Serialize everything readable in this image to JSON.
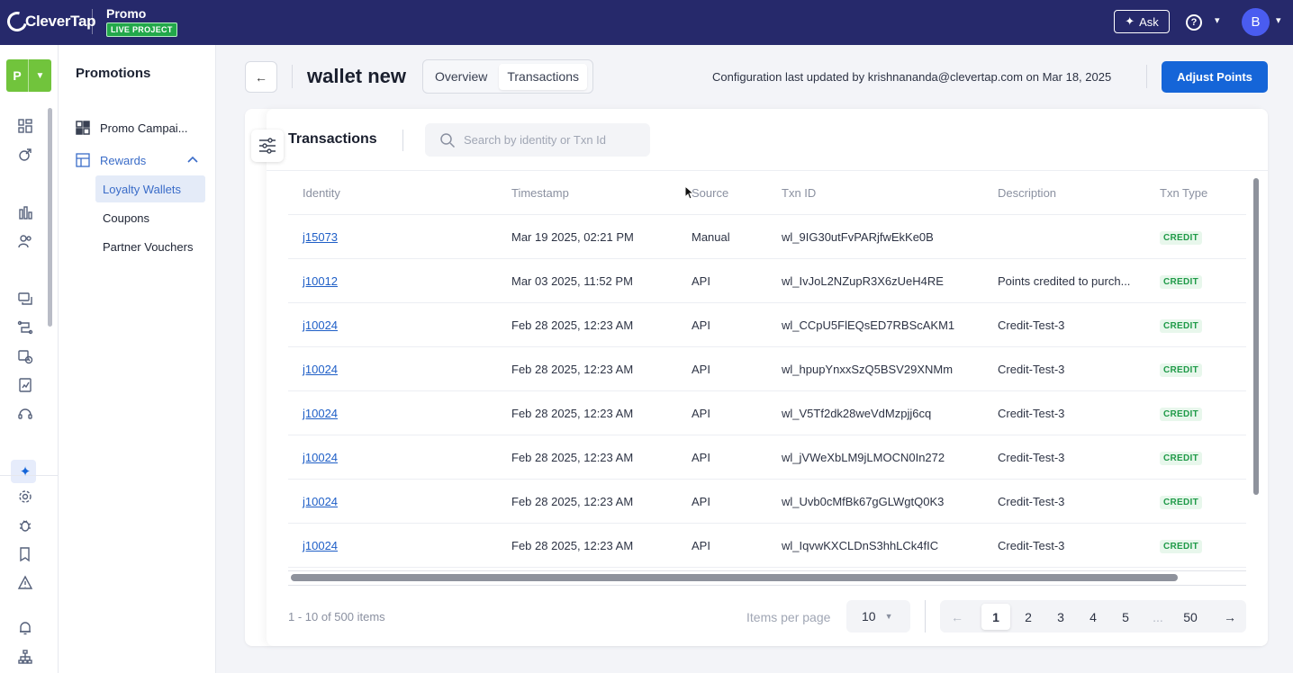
{
  "topbar": {
    "logo_text": "CleverTap",
    "project_name": "Promo",
    "project_badge": "LIVE PROJECT",
    "ask_label": "Ask",
    "help_glyph": "?",
    "avatar_initial": "B"
  },
  "workspace": {
    "initial": "P",
    "color": "#71c43c"
  },
  "sidenav": {
    "title": "Promotions",
    "items": [
      {
        "label": "Promo Campai...",
        "icon": "grid-icon"
      },
      {
        "label": "Rewards",
        "icon": "layout-icon",
        "expanded": true
      }
    ],
    "sub_items": [
      {
        "label": "Loyalty Wallets",
        "active": true
      },
      {
        "label": "Coupons",
        "active": false
      },
      {
        "label": "Partner Vouchers",
        "active": false
      }
    ]
  },
  "header": {
    "title": "wallet new",
    "tabs": [
      "Overview",
      "Transactions"
    ],
    "active_tab": "Transactions",
    "config_text": "Configuration last updated by krishnananda@clevertap.com on Mar 18, 2025",
    "adjust_button": "Adjust Points"
  },
  "transactions": {
    "title": "Transactions",
    "search_placeholder": "Search by identity or Txn Id",
    "columns": [
      "Identity",
      "Timestamp",
      "Source",
      "Txn ID",
      "Description",
      "Txn Type"
    ],
    "rows": [
      {
        "identity": "j15073",
        "timestamp": "Mar 19 2025, 02:21 PM",
        "source": "Manual",
        "txn_id": "wl_9IG30utFvPARjfwEkKe0B",
        "description": "",
        "type": "CREDIT"
      },
      {
        "identity": "j10012",
        "timestamp": "Mar 03 2025, 11:52 PM",
        "source": "API",
        "txn_id": "wl_IvJoL2NZupR3X6zUeH4RE",
        "description": "Points credited to purch...",
        "type": "CREDIT"
      },
      {
        "identity": "j10024",
        "timestamp": "Feb 28 2025, 12:23 AM",
        "source": "API",
        "txn_id": "wl_CCpU5FlEQsED7RBScAKM1",
        "description": "Credit-Test-3",
        "type": "CREDIT"
      },
      {
        "identity": "j10024",
        "timestamp": "Feb 28 2025, 12:23 AM",
        "source": "API",
        "txn_id": "wl_hpupYnxxSzQ5BSV29XNMm",
        "description": "Credit-Test-3",
        "type": "CREDIT"
      },
      {
        "identity": "j10024",
        "timestamp": "Feb 28 2025, 12:23 AM",
        "source": "API",
        "txn_id": "wl_V5Tf2dk28weVdMzpjj6cq",
        "description": "Credit-Test-3",
        "type": "CREDIT"
      },
      {
        "identity": "j10024",
        "timestamp": "Feb 28 2025, 12:23 AM",
        "source": "API",
        "txn_id": "wl_jVWeXbLM9jLMOCN0In272",
        "description": "Credit-Test-3",
        "type": "CREDIT"
      },
      {
        "identity": "j10024",
        "timestamp": "Feb 28 2025, 12:23 AM",
        "source": "API",
        "txn_id": "wl_Uvb0cMfBk67gGLWgtQ0K3",
        "description": "Credit-Test-3",
        "type": "CREDIT"
      },
      {
        "identity": "j10024",
        "timestamp": "Feb 28 2025, 12:23 AM",
        "source": "API",
        "txn_id": "wl_IqvwKXCLDnS3hhLCk4fIC",
        "description": "Credit-Test-3",
        "type": "CREDIT"
      }
    ]
  },
  "footer": {
    "items_count": "1 - 10 of 500 items",
    "items_per_page_label": "Items per page",
    "items_per_page": "10",
    "pages": [
      "1",
      "2",
      "3",
      "4",
      "5",
      "...",
      "50"
    ],
    "current_page": "1"
  },
  "colors": {
    "topbar": "#26296b",
    "primary": "#1565d8",
    "link": "#1f5fc7",
    "credit": "#1f9a48"
  }
}
